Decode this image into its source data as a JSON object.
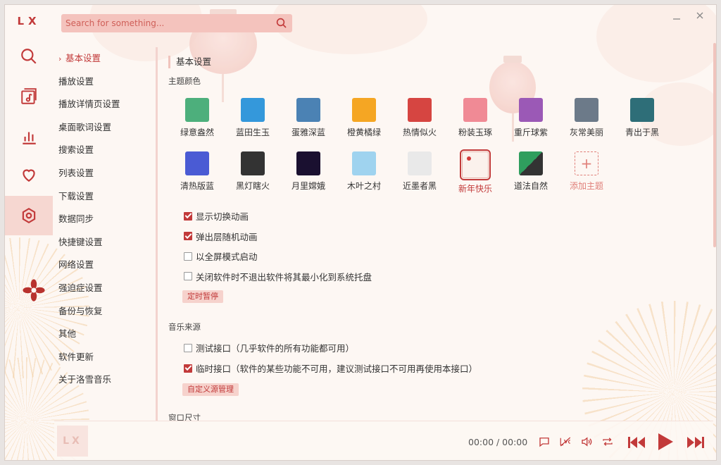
{
  "app": {
    "logo": "LX"
  },
  "search": {
    "placeholder": "Search for something..."
  },
  "sidebar_icons": [
    "search-icon",
    "music-list-icon",
    "leaderboard-icon",
    "heart-icon",
    "settings-icon"
  ],
  "menu": {
    "items": [
      {
        "label": "基本设置",
        "active": true
      },
      {
        "label": "播放设置"
      },
      {
        "label": "播放详情页设置"
      },
      {
        "label": "桌面歌词设置"
      },
      {
        "label": "搜索设置"
      },
      {
        "label": "列表设置"
      },
      {
        "label": "下载设置"
      },
      {
        "label": "数据同步"
      },
      {
        "label": "快捷键设置"
      },
      {
        "label": "网络设置"
      },
      {
        "label": "强迫症设置"
      },
      {
        "label": "备份与恢复"
      },
      {
        "label": "其他"
      },
      {
        "label": "软件更新"
      },
      {
        "label": "关于洛雪音乐"
      }
    ]
  },
  "basic": {
    "title": "基本设置",
    "theme_label": "主题颜色",
    "themes": [
      {
        "name": "绿意盎然",
        "color": "#4daf7c"
      },
      {
        "name": "蓝田生玉",
        "color": "#3498db"
      },
      {
        "name": "蛋雅深蓝",
        "color": "#4b82b4"
      },
      {
        "name": "橙黄橘绿",
        "color": "#f5a623"
      },
      {
        "name": "热情似火",
        "color": "#d64541"
      },
      {
        "name": "粉装玉琢",
        "color": "#f08a95"
      },
      {
        "name": "重斤球紫",
        "color": "#9b59b6"
      },
      {
        "name": "灰常美丽",
        "color": "#6c7a89"
      },
      {
        "name": "青出于黑",
        "color": "#2e6e78"
      },
      {
        "name": "清热版蓝",
        "color": "#4a5bd4"
      },
      {
        "name": "黑灯瞎火",
        "color": "#333333"
      },
      {
        "name": "月里嫦娥",
        "color": "#1a1030"
      },
      {
        "name": "木叶之村",
        "color": "#9fd3ef"
      },
      {
        "name": "近墨者黑",
        "color": "#e9e9e9"
      },
      {
        "name": "新年快乐",
        "color": "#fbf1ec",
        "active": true
      },
      {
        "name": "道法自然",
        "color": "#2f9e5e"
      }
    ],
    "add_theme": "添加主题",
    "checks": [
      {
        "label": "显示切换动画",
        "checked": true
      },
      {
        "label": "弹出层随机动画",
        "checked": true
      },
      {
        "label": "以全屏模式启动",
        "checked": false
      },
      {
        "label": "关闭软件时不退出软件将其最小化到系统托盘",
        "checked": false
      }
    ],
    "timer_button": "定时暂停"
  },
  "source": {
    "label": "音乐来源",
    "options": [
      {
        "label": "测试接口（几乎软件的所有功能都可用）",
        "checked": false
      },
      {
        "label": "临时接口（软件的某些功能不可用，建议测试接口不可用再使用本接口）",
        "checked": true
      }
    ],
    "custom_button": "自定义源管理"
  },
  "window_size": {
    "label": "窗口尺寸"
  },
  "player": {
    "cover_text": "LX",
    "time": "00:00 / 00:00",
    "accent": "#c23a3a"
  }
}
